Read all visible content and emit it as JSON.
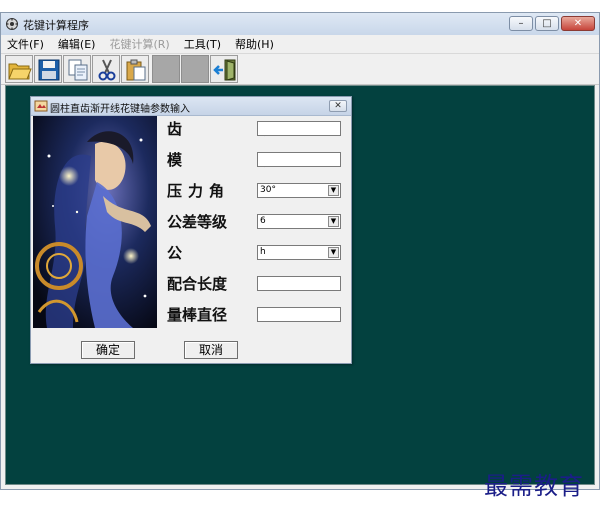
{
  "window": {
    "title": "花键计算程序",
    "controls": {
      "minimize": "–",
      "maximize": "□",
      "close": "✕"
    }
  },
  "menu": [
    {
      "label": "文件(F)",
      "enabled": true
    },
    {
      "label": "编辑(E)",
      "enabled": true
    },
    {
      "label": "花键计算(R)",
      "enabled": false
    },
    {
      "label": "工具(T)",
      "enabled": true
    },
    {
      "label": "帮助(H)",
      "enabled": true
    }
  ],
  "toolbar": {
    "buttons": [
      "open-folder-icon",
      "save-icon",
      "copy-icon",
      "cut-icon",
      "paste-icon",
      "blank",
      "blank",
      "exit-icon"
    ]
  },
  "client_color": "#03413f",
  "dialog": {
    "title": "圆柱直齿渐开线花键轴参数输入",
    "close_glyph": "✕",
    "fields": [
      {
        "label": "齿　数",
        "type": "text",
        "value": ""
      },
      {
        "label": "模　数",
        "type": "text",
        "value": ""
      },
      {
        "label": "压力角",
        "type": "select",
        "value": "30°"
      },
      {
        "label": "公差等级",
        "type": "select",
        "value": "6"
      },
      {
        "label": "公　差",
        "type": "select",
        "value": "h"
      },
      {
        "label": "配合长度",
        "type": "text",
        "value": ""
      },
      {
        "label": "量棒直径",
        "type": "text",
        "value": ""
      }
    ],
    "ok_label": "确定",
    "cancel_label": "取消"
  },
  "watermark": "最需教育"
}
